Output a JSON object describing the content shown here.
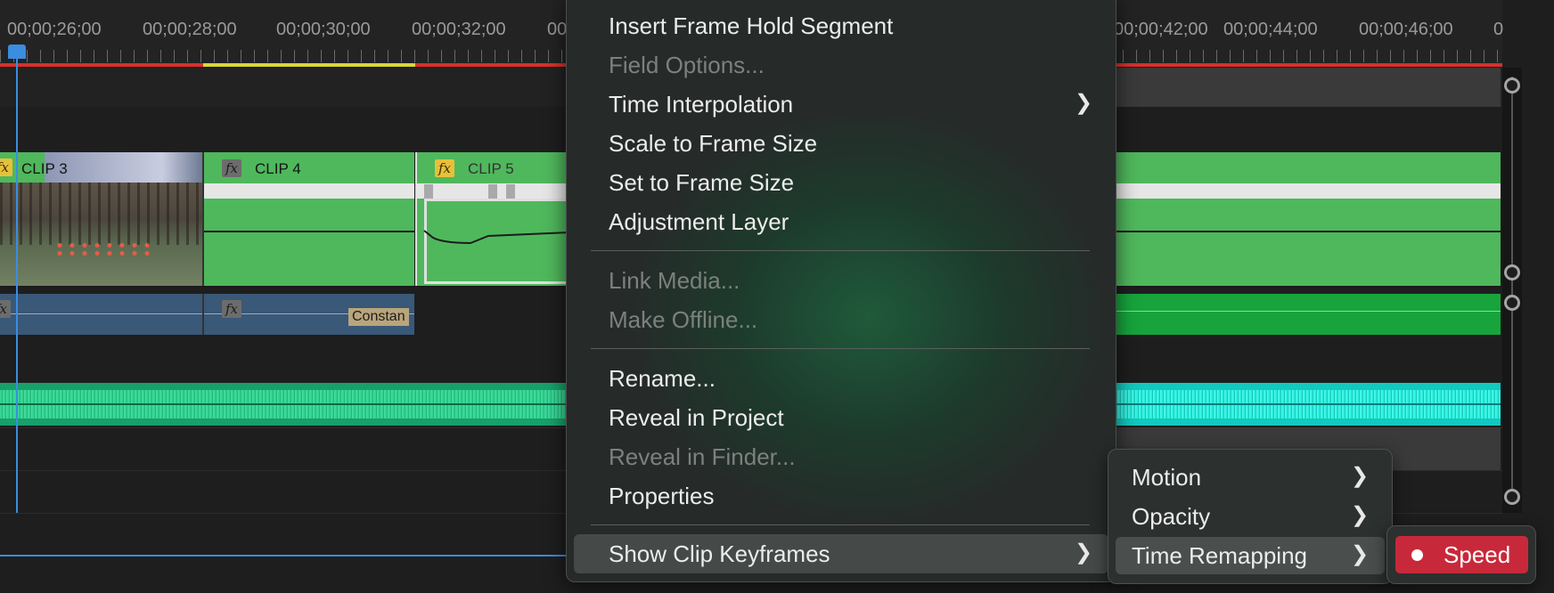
{
  "timeline": {
    "timecodes": [
      "00;00;26;00",
      "00;00;28;00",
      "00;00;30;00",
      "00;00;32;00",
      "00",
      "00;00;42;00",
      "00;00;44;00",
      "00;00;46;00",
      "0"
    ],
    "clips": {
      "clip3": "CLIP 3",
      "clip4": "CLIP 4",
      "clip5": "CLIP 5",
      "constant_label": "Constan"
    },
    "fx_glyph": "fx"
  },
  "context_menu": {
    "items": [
      {
        "label": "Insert Frame Hold Segment",
        "enabled": true
      },
      {
        "label": "Field Options...",
        "enabled": false
      },
      {
        "label": "Time Interpolation",
        "enabled": true,
        "submenu": true
      },
      {
        "label": "Scale to Frame Size",
        "enabled": true
      },
      {
        "label": "Set to Frame Size",
        "enabled": true
      },
      {
        "label": "Adjustment Layer",
        "enabled": true
      },
      {
        "label": "Link Media...",
        "enabled": false
      },
      {
        "label": "Make Offline...",
        "enabled": false
      },
      {
        "label": "Rename...",
        "enabled": true
      },
      {
        "label": "Reveal in Project",
        "enabled": true
      },
      {
        "label": "Reveal in Finder...",
        "enabled": false
      },
      {
        "label": "Properties",
        "enabled": true
      },
      {
        "label": "Show Clip Keyframes",
        "enabled": true,
        "submenu": true,
        "highlighted": true
      }
    ]
  },
  "keyframes_submenu": {
    "items": [
      {
        "label": "Motion",
        "submenu": true
      },
      {
        "label": "Opacity",
        "submenu": true
      },
      {
        "label": "Time Remapping",
        "submenu": true,
        "highlighted": true
      }
    ]
  },
  "time_remapping_submenu": {
    "items": [
      {
        "label": "Speed",
        "checked": true,
        "highlighted": true
      }
    ]
  },
  "colors": {
    "accent_red": "#c8293a",
    "clip_green": "#4fb85c",
    "audio_teal": "#19c98f",
    "playhead_blue": "#3b8de0"
  }
}
